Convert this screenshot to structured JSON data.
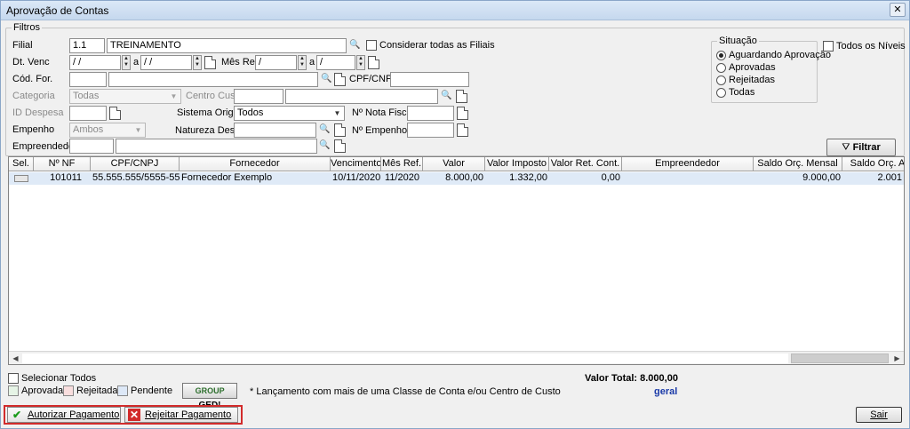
{
  "window": {
    "title": "Aprovação de Contas",
    "close_glyph": "✕"
  },
  "filters": {
    "legend": "Filtros",
    "filial": {
      "label": "Filial",
      "code": "1.1",
      "name": "TREINAMENTO",
      "consider_all": "Considerar todas as Filiais"
    },
    "dt_venc": {
      "label": "Dt. Venc",
      "from": " /  /",
      "sep": "a",
      "to": " /  /"
    },
    "mes_ref": {
      "label": "Mês Ref.",
      "from": " /",
      "sep": "a",
      "to": " /"
    },
    "cod_for": {
      "label": "Cód. For.",
      "code": "",
      "name": ""
    },
    "cpf_cnpj": {
      "label": "CPF/CNPJ",
      "value": ""
    },
    "categoria": {
      "label": "Categoria",
      "value": "Todas"
    },
    "centro_custo": {
      "label": "Centro Custo",
      "code": "",
      "name": ""
    },
    "id_despesa": {
      "label": "ID Despesa",
      "value": ""
    },
    "sistema_origem": {
      "label": "Sistema Origem",
      "value": "Todos"
    },
    "nota_fiscal": {
      "label": "Nº Nota Fiscal",
      "value": ""
    },
    "empenho": {
      "label": "Empenho",
      "value": "Ambos"
    },
    "natureza": {
      "label": "Natureza Desp.",
      "value": ""
    },
    "n_empenho": {
      "label": "Nº Empenho",
      "value": ""
    },
    "empreendedor": {
      "label": "Empreendedor",
      "code": "",
      "name": ""
    },
    "filtrar_label": "Filtrar"
  },
  "situacao": {
    "legend": "Situação",
    "options": [
      "Aguardando Aprovação",
      "Aprovadas",
      "Rejeitadas",
      "Todas"
    ],
    "selected": "Aguardando Aprovação"
  },
  "todos_niveis": "Todos os Níveis",
  "grid": {
    "columns": [
      "Sel.",
      "Nº NF",
      "CPF/CNPJ",
      "Fornecedor",
      "Vencimento",
      "Mês Ref.",
      "Valor",
      "Valor Imposto",
      "Valor Ret. Cont.",
      "Empreendedor",
      "Saldo Orç. Mensal",
      "Saldo Orç. A"
    ],
    "rows": [
      {
        "sel": "",
        "nf": "101011",
        "cpf": "55.555.555/5555-55",
        "fornecedor": "Fornecedor Exemplo",
        "vencimento": "10/11/2020",
        "mes_ref": "11/2020",
        "valor": "8.000,00",
        "imposto": "1.332,00",
        "ret_cont": "0,00",
        "empreendedor": "",
        "saldo_mensal": "9.000,00",
        "saldo_a": "2.001"
      }
    ]
  },
  "footer": {
    "selecionar_todos": "Selecionar Todos",
    "legend_aprovada": "Aprovada",
    "legend_rejeitada": "Rejeitada",
    "legend_pendente": "Pendente",
    "ged_prefix": "GROUP",
    "ged_label": "GED!",
    "note": "* Lançamento com mais de uma Classe de Conta e/ou Centro de Custo",
    "valor_total": "Valor Total: 8.000,00",
    "geral": "geral",
    "autorizar": "Autorizar Pagamento",
    "rejeitar": "Rejeitar Pagamento",
    "sair": "Sair"
  },
  "colors": {
    "row_highlight": "#dfeaf7",
    "aprovada": "#e6f4e6",
    "rejeitada": "#f9dede",
    "pendente": "#dde8f7",
    "accent_red": "#d22b2b",
    "geral": "#1a3aa8"
  }
}
